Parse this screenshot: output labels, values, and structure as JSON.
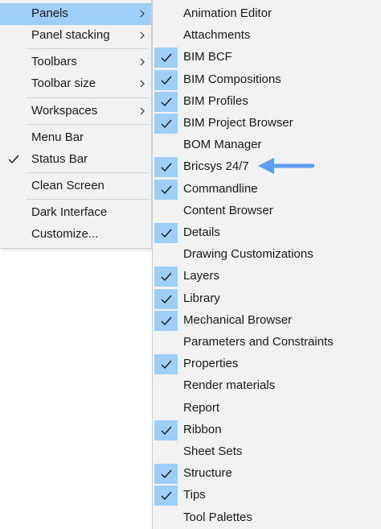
{
  "left_menu": {
    "items": [
      {
        "label": "Panels",
        "submenu": true,
        "highlighted": true,
        "checked": false
      },
      {
        "label": "Panel stacking",
        "submenu": true,
        "highlighted": false,
        "checked": false
      },
      {
        "label": "Toolbars",
        "submenu": true,
        "highlighted": false,
        "checked": false
      },
      {
        "label": "Toolbar size",
        "submenu": true,
        "highlighted": false,
        "checked": false
      },
      {
        "label": "Workspaces",
        "submenu": true,
        "highlighted": false,
        "checked": false
      },
      {
        "label": "Menu Bar",
        "submenu": false,
        "highlighted": false,
        "checked": false
      },
      {
        "label": "Status Bar",
        "submenu": false,
        "highlighted": false,
        "checked": true
      },
      {
        "label": "Clean Screen",
        "submenu": false,
        "highlighted": false,
        "checked": false
      },
      {
        "label": "Dark Interface",
        "submenu": false,
        "highlighted": false,
        "checked": false
      },
      {
        "label": "Customize...",
        "submenu": false,
        "highlighted": false,
        "checked": false
      }
    ]
  },
  "panels_submenu": {
    "items": [
      {
        "label": "Animation Editor",
        "checked": false
      },
      {
        "label": "Attachments",
        "checked": false
      },
      {
        "label": "BIM BCF",
        "checked": true
      },
      {
        "label": "BIM Compositions",
        "checked": true
      },
      {
        "label": "BIM Profiles",
        "checked": true
      },
      {
        "label": "BIM Project Browser",
        "checked": true
      },
      {
        "label": "BOM Manager",
        "checked": false
      },
      {
        "label": "Bricsys 24/7",
        "checked": true
      },
      {
        "label": "Commandline",
        "checked": true
      },
      {
        "label": "Content Browser",
        "checked": false
      },
      {
        "label": "Details",
        "checked": true
      },
      {
        "label": "Drawing Customizations",
        "checked": false
      },
      {
        "label": "Layers",
        "checked": true
      },
      {
        "label": "Library",
        "checked": true
      },
      {
        "label": "Mechanical Browser",
        "checked": true
      },
      {
        "label": "Parameters and Constraints",
        "checked": false
      },
      {
        "label": "Properties",
        "checked": true
      },
      {
        "label": "Render materials",
        "checked": false
      },
      {
        "label": "Report",
        "checked": false
      },
      {
        "label": "Ribbon",
        "checked": true
      },
      {
        "label": "Sheet Sets",
        "checked": false
      },
      {
        "label": "Structure",
        "checked": true
      },
      {
        "label": "Tips",
        "checked": true
      },
      {
        "label": "Tool Palettes",
        "checked": false
      }
    ]
  },
  "colors": {
    "highlight": "#9fcef9",
    "menu_background": "#f2f2f2",
    "annotation_arrow": "#5b9ef0"
  }
}
